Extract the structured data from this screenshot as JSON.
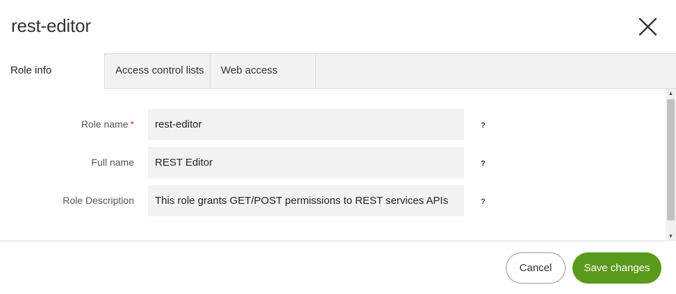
{
  "dialog": {
    "title": "rest-editor"
  },
  "tabs": [
    {
      "label": "Role info",
      "active": true
    },
    {
      "label": "Access control lists",
      "active": false
    },
    {
      "label": "Web access",
      "active": false
    }
  ],
  "form": {
    "role_name": {
      "label": "Role name",
      "required_mark": "*",
      "value": "rest-editor",
      "help": "?"
    },
    "full_name": {
      "label": "Full name",
      "value": "REST Editor",
      "help": "?"
    },
    "role_description": {
      "label": "Role Description",
      "value": "This role grants GET/POST permissions to REST services APIs",
      "help": "?"
    }
  },
  "footer": {
    "cancel_label": "Cancel",
    "save_label": "Save changes"
  },
  "colors": {
    "primary": "#5a9a1a",
    "required": "#d9342b",
    "field_bg": "#f2f2f2",
    "tabbar_bg": "#f2f2f2"
  },
  "icons": {
    "close": "close-icon",
    "scroll_up": "triangle-up-icon",
    "scroll_down": "triangle-down-icon"
  }
}
